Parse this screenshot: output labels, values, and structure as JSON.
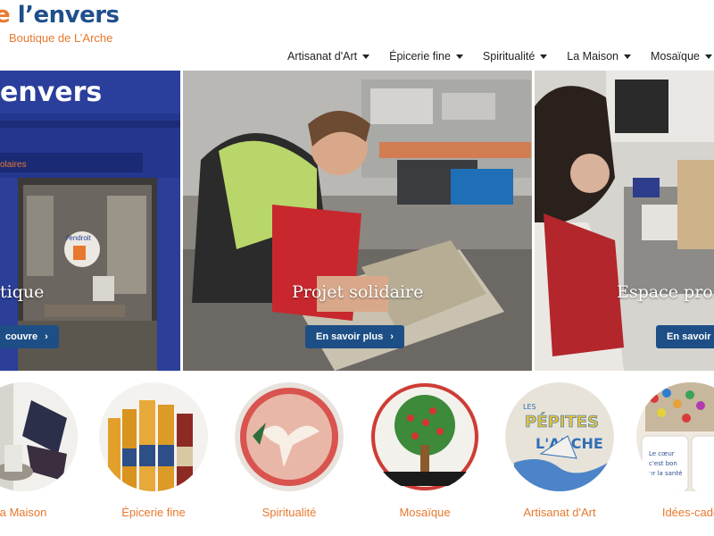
{
  "brand": {
    "name": "l’envers",
    "subtitle": "Boutique de L’Arche",
    "primary_color": "#1e4f8c",
    "accent_color": "#e8782f"
  },
  "nav": {
    "items": [
      {
        "label": "Artisanat d'Art"
      },
      {
        "label": "Épicerie fine"
      },
      {
        "label": "Spiritualité"
      },
      {
        "label": "La Maison"
      },
      {
        "label": "Mosaïque"
      }
    ]
  },
  "hero": {
    "panels": [
      {
        "title": "tique",
        "button": "couvre",
        "storefront_sign": "envers",
        "window_sign": "olaires",
        "window_text": "l'endroit"
      },
      {
        "title": "Projet solidaire",
        "button": "En savoir plus"
      },
      {
        "title": "Espace pro",
        "button": "En savoir"
      }
    ]
  },
  "categories": [
    {
      "label": "a Maison"
    },
    {
      "label": "Épicerie fine"
    },
    {
      "label": "Spiritualité"
    },
    {
      "label": "Mosaïque"
    },
    {
      "label": "Artisanat d'Art",
      "plate_text_1": "PÉPITES",
      "plate_text_2": "L'ARCHE",
      "plate_text_small": "LES"
    },
    {
      "label": "Idées-cade",
      "mug_text": "Le cœur c'est bon ur la santé"
    }
  ]
}
